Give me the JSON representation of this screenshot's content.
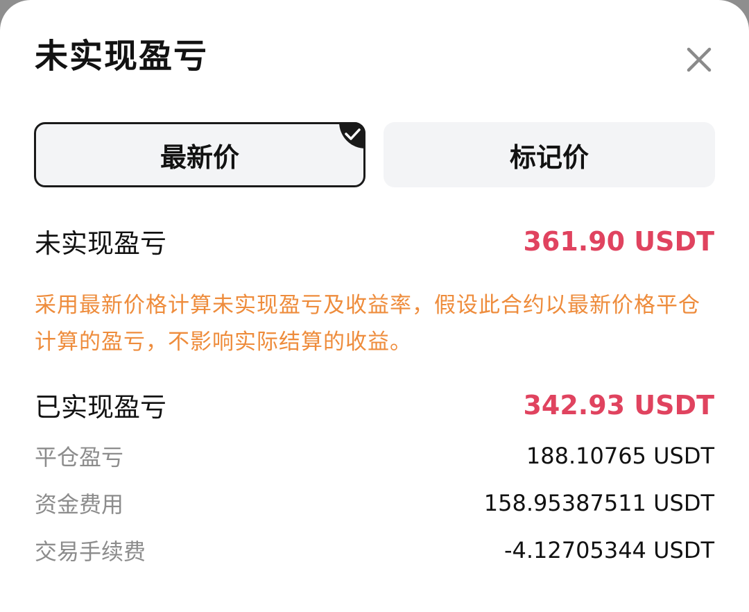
{
  "header": {
    "title": "未实现盈亏",
    "close_icon": "close-icon"
  },
  "tabs": [
    {
      "label": "最新价",
      "active": true,
      "badge_icon": "check-icon"
    },
    {
      "label": "标记价",
      "active": false
    }
  ],
  "unrealized": {
    "label": "未实现盈亏",
    "value": "361.90 USDT",
    "note": "采用最新价格计算未实现盈亏及收益率，假设此合约以最新价格平仓计算的盈亏，不影响实际结算的收益。"
  },
  "realized": {
    "label": "已实现盈亏",
    "value": "342.93 USDT",
    "items": [
      {
        "label": "平仓盈亏",
        "value": "188.10765 USDT"
      },
      {
        "label": "资金费用",
        "value": "158.95387511 USDT"
      },
      {
        "label": "交易手续费",
        "value": "-4.12705344 USDT"
      }
    ]
  },
  "colors": {
    "accent_red": "#e0435f",
    "note_orange": "#ee8c3c",
    "tab_bg": "#f3f4f6"
  }
}
